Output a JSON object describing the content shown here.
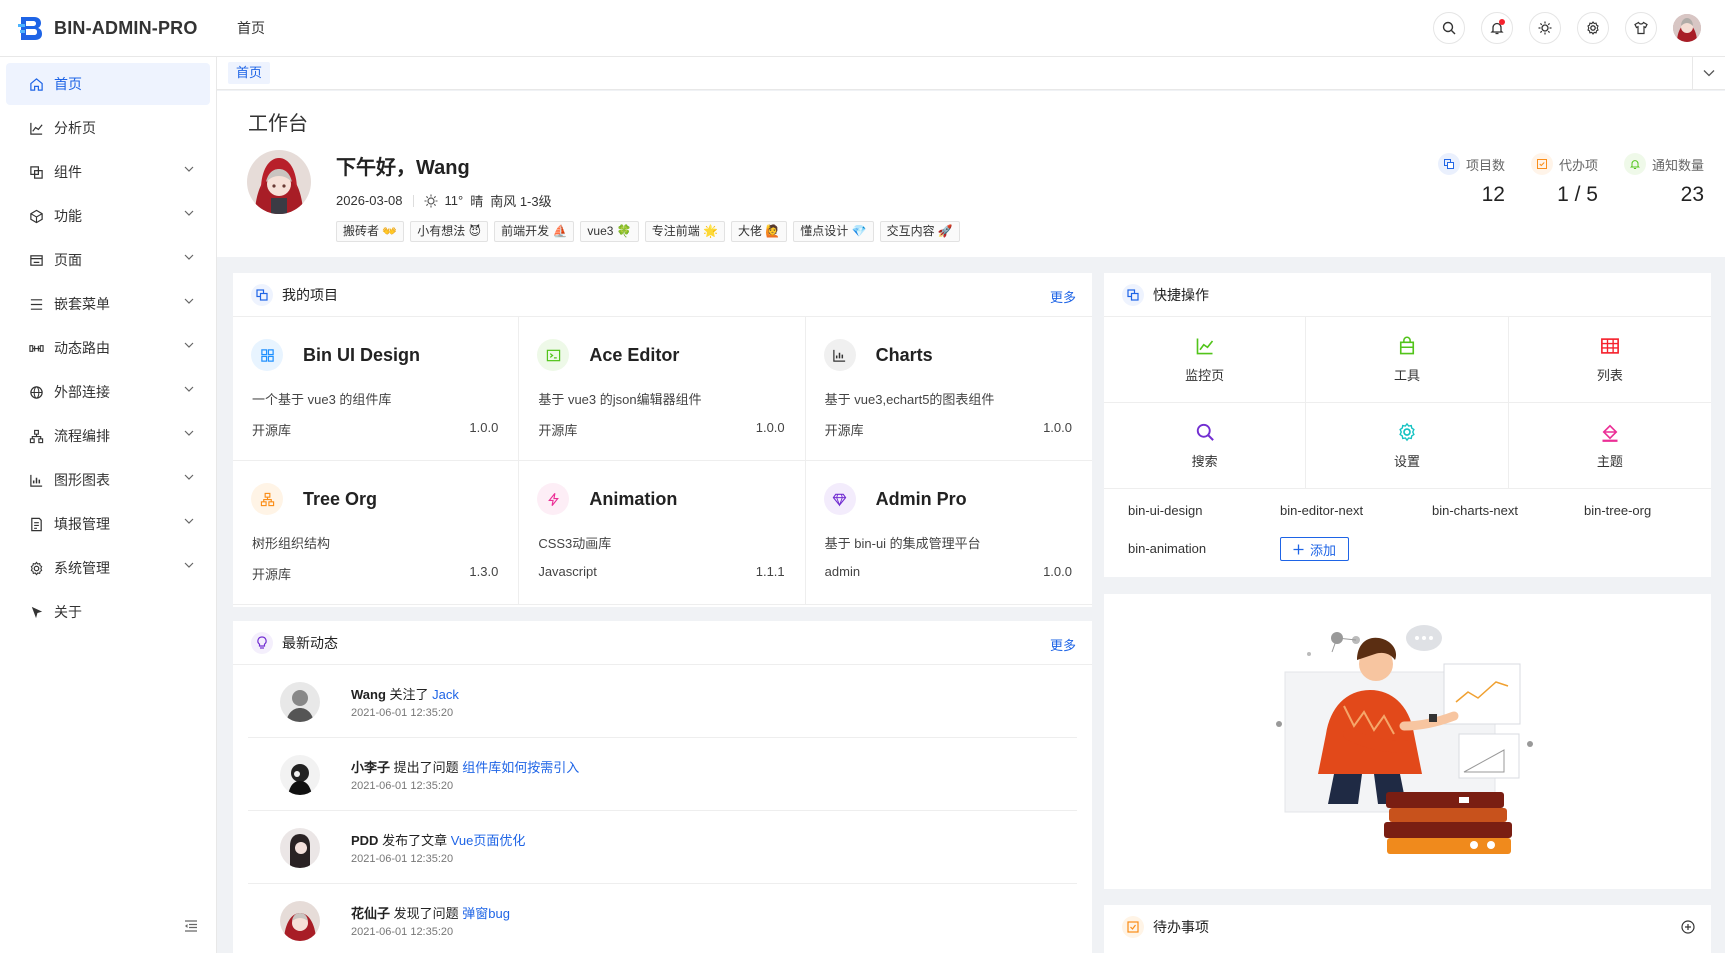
{
  "app": {
    "title": "BIN-ADMIN-PRO",
    "header_crumb": "首页"
  },
  "header_icons": [
    "search-icon",
    "bell-icon",
    "sun-icon",
    "gear-icon",
    "shirt-icon",
    "user-avatar"
  ],
  "sidebar": {
    "items": [
      {
        "label": "首页",
        "icon": "home-icon",
        "active": true,
        "has_children": false
      },
      {
        "label": "分析页",
        "icon": "line-chart-icon",
        "has_children": false
      },
      {
        "label": "组件",
        "icon": "component-icon",
        "has_children": true
      },
      {
        "label": "功能",
        "icon": "cube-icon",
        "has_children": true
      },
      {
        "label": "页面",
        "icon": "page-icon",
        "has_children": true
      },
      {
        "label": "嵌套菜单",
        "icon": "list-icon",
        "has_children": true
      },
      {
        "label": "动态路由",
        "icon": "route-icon",
        "has_children": true
      },
      {
        "label": "外部连接",
        "icon": "globe-icon",
        "has_children": true
      },
      {
        "label": "流程编排",
        "icon": "flow-icon",
        "has_children": true
      },
      {
        "label": "图形图表",
        "icon": "bar-chart-icon",
        "has_children": true
      },
      {
        "label": "填报管理",
        "icon": "form-icon",
        "has_children": true
      },
      {
        "label": "系统管理",
        "icon": "settings-icon",
        "has_children": true
      },
      {
        "label": "关于",
        "icon": "pointer-icon",
        "has_children": false
      }
    ]
  },
  "tabs": [
    {
      "label": "首页",
      "active": true
    }
  ],
  "workbench": {
    "title": "工作台",
    "greeting": "下午好，Wang",
    "date": "2026-03-08",
    "temp": "11°",
    "weather": "晴",
    "wind": "南风 1-3级",
    "tags": [
      "搬砖者 👐",
      "小有想法 😈",
      "前端开发 ⛵",
      "vue3 🍀",
      "专注前端 🌟",
      "大佬 🙋",
      "懂点设计 💎",
      "交互内容 🚀"
    ],
    "stats": [
      {
        "label": "项目数",
        "value": "12",
        "icon": "project-icon",
        "color": "#1e64e6"
      },
      {
        "label": "代办项",
        "value": "1 / 5",
        "icon": "todo-icon",
        "color": "#fa8c16"
      },
      {
        "label": "通知数量",
        "value": "23",
        "icon": "bell-icon",
        "color": "#52c41a"
      }
    ]
  },
  "projects": {
    "title": "我的项目",
    "more": "更多",
    "items": [
      {
        "name": "Bin UI Design",
        "desc": "一个基于 vue3 的组件库",
        "type": "开源库",
        "version": "1.0.0",
        "icon": "grid-icon",
        "color": "#1e90ff",
        "bg": "#e8f4ff"
      },
      {
        "name": "Ace Editor",
        "desc": "基于 vue3 的json编辑器组件",
        "type": "开源库",
        "version": "1.0.0",
        "icon": "terminal-icon",
        "color": "#52c41a",
        "bg": "#eef9e8"
      },
      {
        "name": "Charts",
        "desc": "基于 vue3,echart5的图表组件",
        "type": "开源库",
        "version": "1.0.0",
        "icon": "bar-chart-icon",
        "color": "#333333",
        "bg": "#f0f0f0"
      },
      {
        "name": "Tree Org",
        "desc": "树形组织结构",
        "type": "开源库",
        "version": "1.3.0",
        "icon": "org-icon",
        "color": "#fa8c16",
        "bg": "#fff4e6"
      },
      {
        "name": "Animation",
        "desc": "CSS3动画库",
        "type": "Javascript",
        "version": "1.1.1",
        "icon": "lightning-icon",
        "color": "#eb2f96",
        "bg": "#fdeef6"
      },
      {
        "name": "Admin Pro",
        "desc": "基于 bin-ui 的集成管理平台",
        "type": "admin",
        "version": "1.0.0",
        "icon": "diamond-icon",
        "color": "#722ed1",
        "bg": "#f3ecfc"
      }
    ]
  },
  "quick_actions": {
    "title": "快捷操作",
    "items": [
      {
        "label": "监控页",
        "icon": "line-chart-icon",
        "color": "#52c41a"
      },
      {
        "label": "工具",
        "icon": "bag-icon",
        "color": "#52c41a"
      },
      {
        "label": "列表",
        "icon": "table-icon",
        "color": "#f5222d"
      },
      {
        "label": "搜索",
        "icon": "search-icon",
        "color": "#722ed1"
      },
      {
        "label": "设置",
        "icon": "gear-icon",
        "color": "#13c2c2"
      },
      {
        "label": "主题",
        "icon": "paint-bucket-icon",
        "color": "#eb2f96"
      }
    ],
    "links": [
      "bin-ui-design",
      "bin-editor-next",
      "bin-charts-next",
      "bin-tree-org",
      "bin-animation"
    ],
    "add_label": "添加"
  },
  "activity": {
    "title": "最新动态",
    "more": "更多",
    "items": [
      {
        "user": "Wang",
        "action": "关注了",
        "target": "Jack",
        "time": "2021-06-01 12:35:20"
      },
      {
        "user": "小李子",
        "action": "提出了问题",
        "target": "组件库如何按需引入",
        "time": "2021-06-01 12:35:20"
      },
      {
        "user": "PDD",
        "action": "发布了文章",
        "target": "Vue页面优化",
        "time": "2021-06-01 12:35:20"
      },
      {
        "user": "花仙子",
        "action": "发现了问题",
        "target": "弹窗bug",
        "time": "2021-06-01 12:35:20"
      }
    ]
  },
  "todo": {
    "title": "待办事项"
  }
}
